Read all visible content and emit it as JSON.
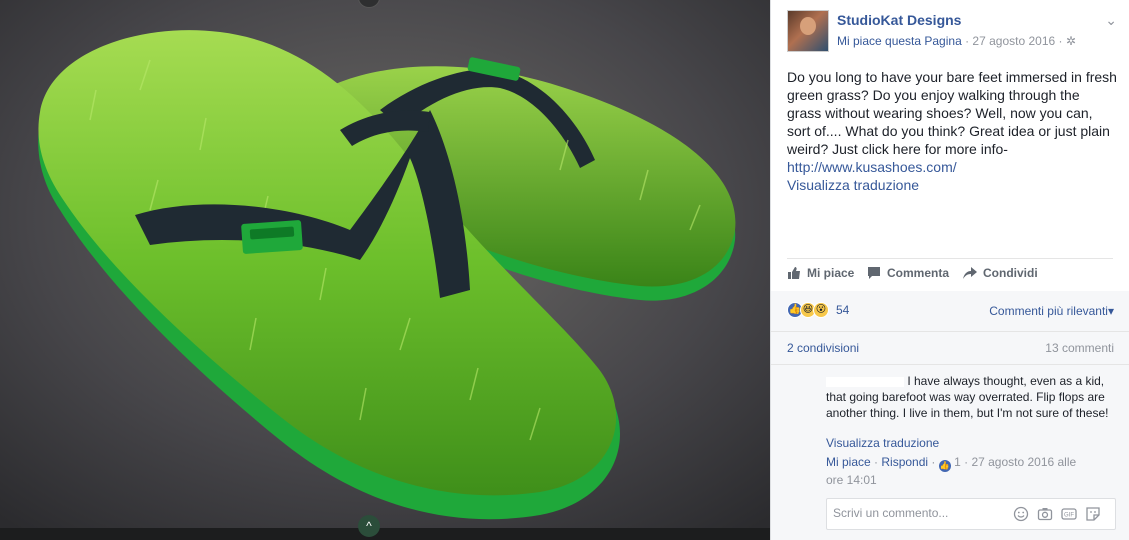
{
  "post": {
    "page_name": "StudioKat Designs",
    "like_page": "Mi piace questa Pagina",
    "separator": " · ",
    "date": "27 agosto 2016",
    "privacy_icon": "gear-icon",
    "body": "Do you long to have your bare feet immersed in fresh green grass? Do you enjoy walking through the grass without wearing shoes? Well, now you can, sort of.... What do you think? Great idea or just plain weird? Just click here for more info-",
    "link": "http://www.kusashoes.com/",
    "translate": "Visualizza traduzione"
  },
  "actions": {
    "like": "Mi piace",
    "comment": "Commenta",
    "share": "Condividi"
  },
  "reactions": {
    "count": "54",
    "sort_label": "Commenti più rilevanti",
    "sort_caret": "▾",
    "shares": "2 condivisioni",
    "comments": "13 commenti"
  },
  "comment": {
    "text": "I have always thought, even as a kid, that going barefoot was way overrated. Flip flops are another thing. I live in them, but I'm not sure of these!",
    "translate": "Visualizza traduzione",
    "like": "Mi piace",
    "reply": "Rispondi",
    "like_count": "1",
    "timestamp": "27 agosto 2016 alle ore 14:01",
    "dot": " · "
  },
  "composer": {
    "placeholder": "Scrivi un commento..."
  },
  "colors": {
    "link": "#365899",
    "grass": "#6fbf2a",
    "sole": "#1fa83a",
    "strap": "#1f2a33"
  }
}
